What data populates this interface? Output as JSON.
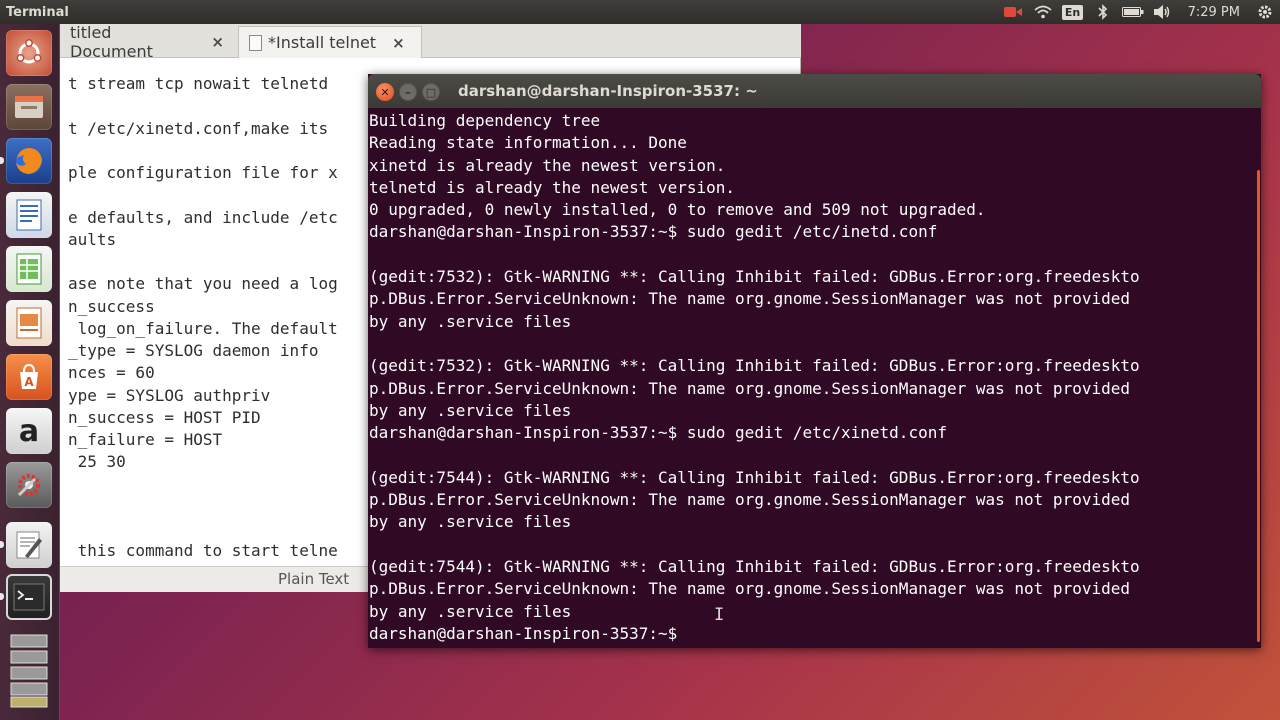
{
  "top_panel": {
    "app_title": "Terminal",
    "language": "En",
    "clock": "7:29 PM",
    "icons": [
      "camera-icon",
      "wifi-icon",
      "bluetooth-icon",
      "battery-icon",
      "volume-icon",
      "gear-icon"
    ]
  },
  "launcher": {
    "items": [
      "ubuntu-dash-icon",
      "files-icon",
      "firefox-icon",
      "writer-icon",
      "calc-icon",
      "impress-icon",
      "software-center-icon",
      "amazon-icon",
      "settings-icon",
      "gedit-icon",
      "terminal-icon",
      "workspaces-icon"
    ],
    "amazon_glyph": "a"
  },
  "gedit": {
    "tabs": [
      {
        "label": "titled Document",
        "close": "×"
      },
      {
        "label": "*Install telnet",
        "close": "×"
      }
    ],
    "lines": [
      "t stream tcp nowait telnetd",
      "",
      "t /etc/xinetd.conf,make its",
      "",
      "ple configuration file for x",
      "",
      "e defaults, and include /etc",
      "aults",
      "",
      "ase note that you need a log",
      "n_success",
      " log_on_failure. The default",
      "_type = SYSLOG daemon info",
      "nces = 60",
      "ype = SYSLOG authpriv",
      "n_success = HOST PID",
      "n_failure = HOST",
      " 25 30",
      "",
      "",
      "",
      " this command to start telne"
    ],
    "status_mode": "Plain Text"
  },
  "terminal": {
    "title": "darshan@darshan-Inspiron-3537: ~",
    "lines": [
      "Building dependency tree",
      "Reading state information... Done",
      "xinetd is already the newest version.",
      "telnetd is already the newest version.",
      "0 upgraded, 0 newly installed, 0 to remove and 509 not upgraded.",
      "darshan@darshan-Inspiron-3537:~$ sudo gedit /etc/inetd.conf",
      "",
      "(gedit:7532): Gtk-WARNING **: Calling Inhibit failed: GDBus.Error:org.freedeskto",
      "p.DBus.Error.ServiceUnknown: The name org.gnome.SessionManager was not provided",
      "by any .service files",
      "",
      "(gedit:7532): Gtk-WARNING **: Calling Inhibit failed: GDBus.Error:org.freedeskto",
      "p.DBus.Error.ServiceUnknown: The name org.gnome.SessionManager was not provided",
      "by any .service files",
      "darshan@darshan-Inspiron-3537:~$ sudo gedit /etc/xinetd.conf",
      "",
      "(gedit:7544): Gtk-WARNING **: Calling Inhibit failed: GDBus.Error:org.freedeskto",
      "p.DBus.Error.ServiceUnknown: The name org.gnome.SessionManager was not provided",
      "by any .service files",
      "",
      "(gedit:7544): Gtk-WARNING **: Calling Inhibit failed: GDBus.Error:org.freedeskto",
      "p.DBus.Error.ServiceUnknown: The name org.gnome.SessionManager was not provided",
      "by any .service files",
      "darshan@darshan-Inspiron-3537:~$"
    ]
  },
  "colors": {
    "terminal_bg": "#300a24",
    "accent": "#e95420",
    "panel_bg": "#3c3b37"
  }
}
